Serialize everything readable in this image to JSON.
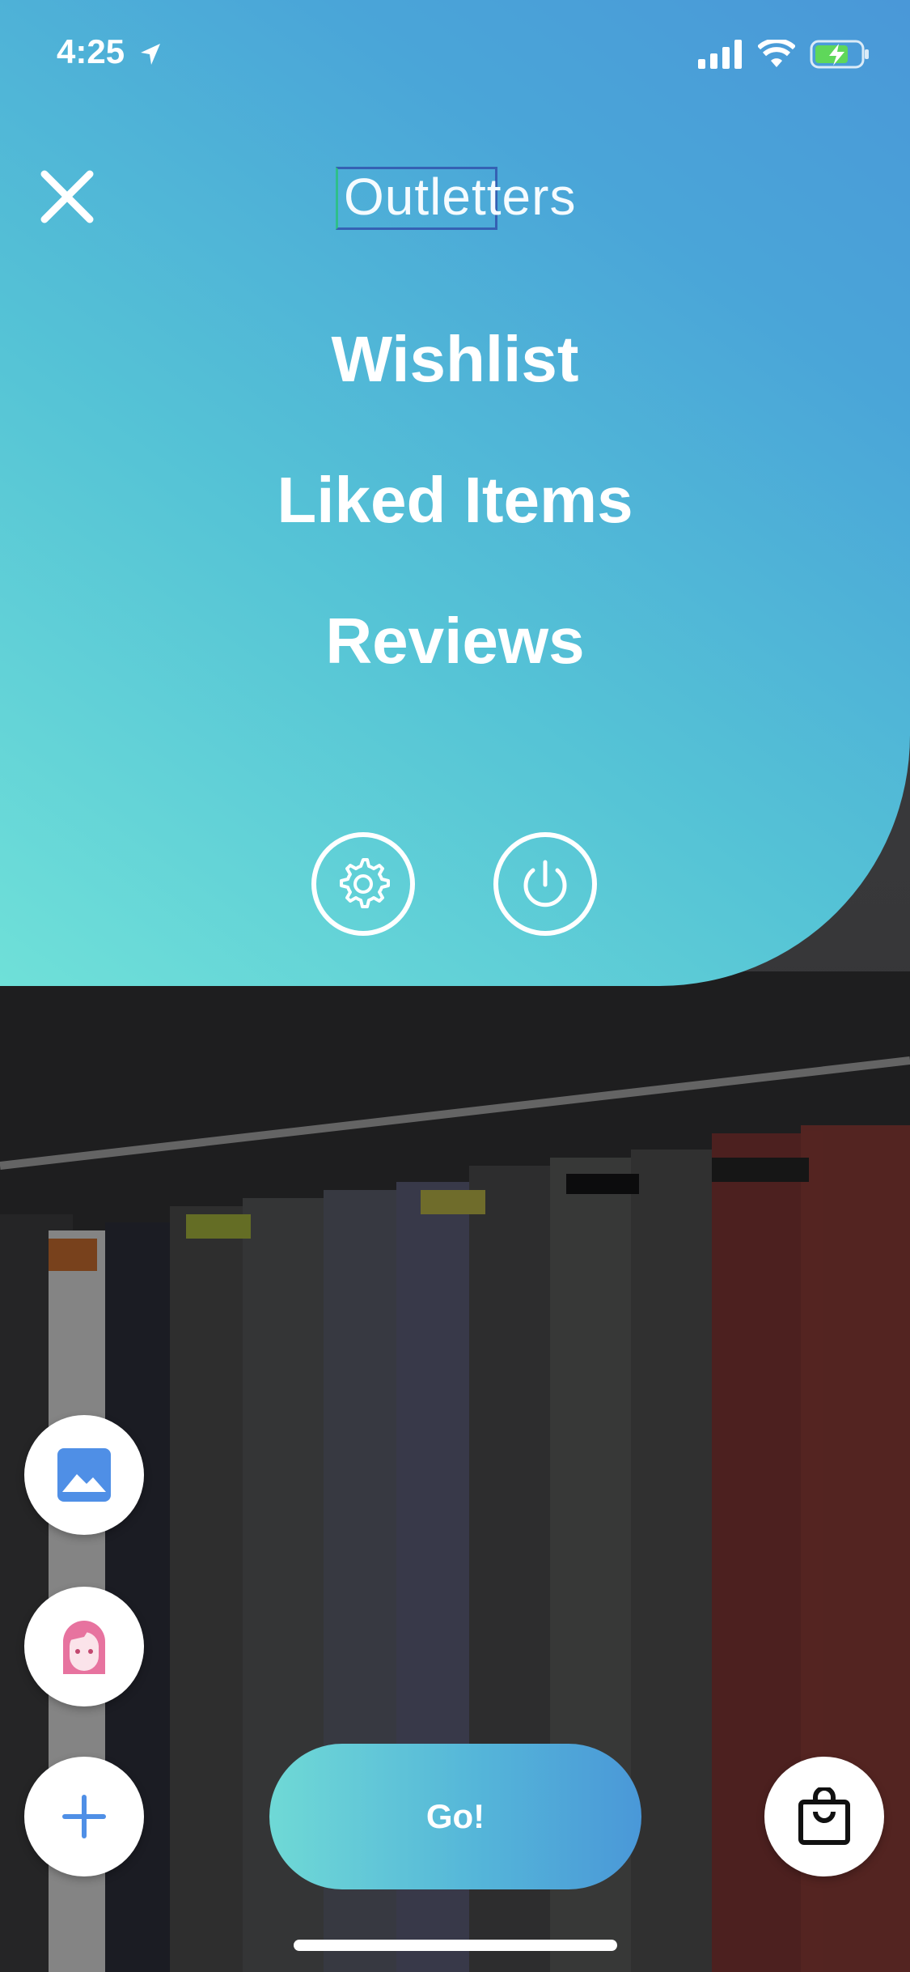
{
  "status_bar": {
    "time": "4:25",
    "icons": [
      "location-arrow-icon",
      "cellular-signal-icon",
      "wifi-icon",
      "battery-charging-icon"
    ]
  },
  "header": {
    "logo_text": "Outletters",
    "close_icon": "close-icon"
  },
  "menu": {
    "items": [
      {
        "label": "Wishlist"
      },
      {
        "label": "Liked Items"
      },
      {
        "label": "Reviews"
      }
    ],
    "settings_icon": "gear-icon",
    "logout_icon": "power-icon"
  },
  "floating_actions": {
    "gallery_icon": "image-icon",
    "avatar_icon": "avatar-icon",
    "add_icon": "plus-icon",
    "bag_icon": "shopping-bag-icon"
  },
  "go_button": {
    "label": "Go!"
  },
  "colors": {
    "gradient_start": "#6fe0d8",
    "gradient_end": "#4a98d8",
    "avatar_pink": "#e7739f",
    "gallery_blue": "#4f8fe6"
  }
}
